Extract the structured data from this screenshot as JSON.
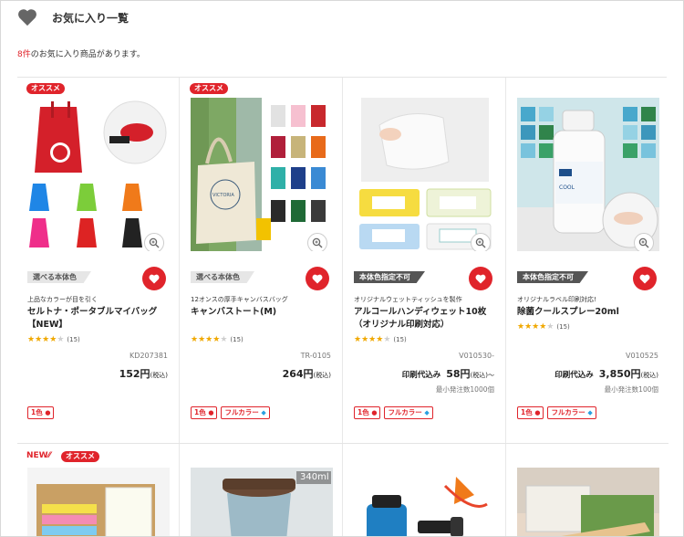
{
  "header": {
    "title": "お気に入り一覧",
    "icon": "heart-icon"
  },
  "summary": {
    "count": "8件",
    "text": "のお気に入り商品があります。"
  },
  "colors": {
    "accent": "#e0242b",
    "star": "#f0a800"
  },
  "products": [
    {
      "badge": "オススメ",
      "color_tag": "選べる本体色",
      "subtitle": "上品なカラーが目を引く",
      "name": "セルトナ・ポータブルマイバッグ【NEW】",
      "stars": "★★★★☆",
      "rating_count": "(15)",
      "code": "KD207381",
      "price_prefix": "",
      "price": "152円",
      "tax": "(税込)",
      "min_qty": "",
      "tags": [
        "1色",
        ""
      ]
    },
    {
      "badge": "オススメ",
      "color_tag": "選べる本体色",
      "subtitle": "12オンスの厚手キャンバスバッグ",
      "name": "キャンバストート(M)",
      "stars": "★★★★☆",
      "rating_count": "(15)",
      "code": "TR-0105",
      "price_prefix": "",
      "price": "264円",
      "tax": "(税込)",
      "min_qty": "",
      "tags": [
        "1色",
        "フルカラー"
      ]
    },
    {
      "badge": "",
      "color_tag": "本体色指定不可",
      "subtitle": "オリジナルウェットティッシュを製作",
      "name": "アルコールハンディウェット10枚（オリジナル印刷対応）",
      "stars": "★★★★☆",
      "rating_count": "(15)",
      "code": "V010530-",
      "price_prefix": "印刷代込み",
      "price": "58円",
      "tax": "(税込)〜",
      "min_qty": "最小発注数1000個",
      "tags": [
        "1色",
        "フルカラー"
      ]
    },
    {
      "badge": "",
      "color_tag": "本体色指定不可",
      "subtitle": "オリジナルラベル印刷対応!",
      "name": "除菌クールスプレー20ml",
      "stars": "★★★★☆",
      "rating_count": "(15)",
      "code": "V010525",
      "price_prefix": "印刷代込み",
      "price": "3,850円",
      "tax": "(税込)",
      "min_qty": "最小発注数100個",
      "tags": [
        "1色",
        "フルカラー"
      ]
    }
  ],
  "row2": {
    "new_label": "NEW",
    "badge": "オススメ",
    "size_label": "340ml"
  }
}
